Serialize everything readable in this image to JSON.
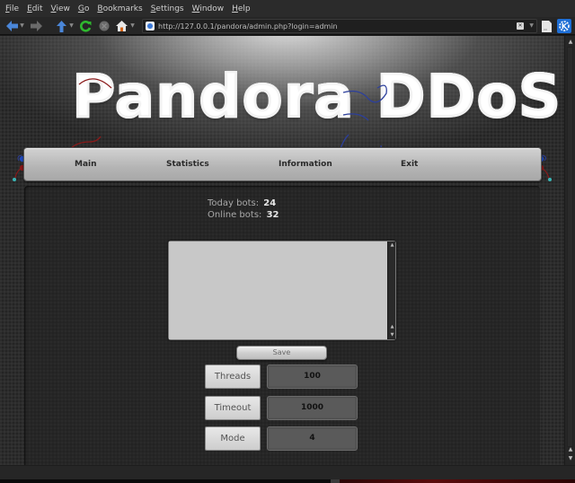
{
  "browser": {
    "menu": [
      "File",
      "Edit",
      "View",
      "Go",
      "Bookmarks",
      "Settings",
      "Window",
      "Help"
    ],
    "toolbar_icons": {
      "back": "back-arrow-icon",
      "forward": "forward-arrow-icon",
      "up": "up-arrow-icon",
      "reload": "reload-icon",
      "stop": "stop-icon",
      "home": "home-icon",
      "clear": "clear-location-icon",
      "bookmark": "bookmark-page-icon",
      "kde": "kde-logo-icon"
    },
    "url": "http://127.0.0.1/pandora/admin.php?login=admin"
  },
  "page": {
    "logo_text": "Pandora DDoS",
    "nav": [
      {
        "label": "Main"
      },
      {
        "label": "Statistics"
      },
      {
        "label": "Information"
      },
      {
        "label": "Exit"
      }
    ],
    "stats": {
      "today_label": "Today bots:",
      "today_value": "24",
      "online_label": "Online bots:",
      "online_value": "32"
    },
    "textarea": {
      "value": ""
    },
    "save_label": "Save",
    "fields": [
      {
        "label": "Threads",
        "value": "100"
      },
      {
        "label": "Timeout",
        "value": "1000"
      },
      {
        "label": "Mode",
        "value": "4"
      }
    ]
  },
  "colors": {
    "background": "#2c2c2c",
    "nav_bg": "#bdbdbd",
    "textarea_bg": "#c8c8c8",
    "field_value_bg": "#5a5a5a",
    "wire_red": "#8a1a1a",
    "wire_blue": "#2c3f9c",
    "node_cyan": "#39b4b4"
  }
}
